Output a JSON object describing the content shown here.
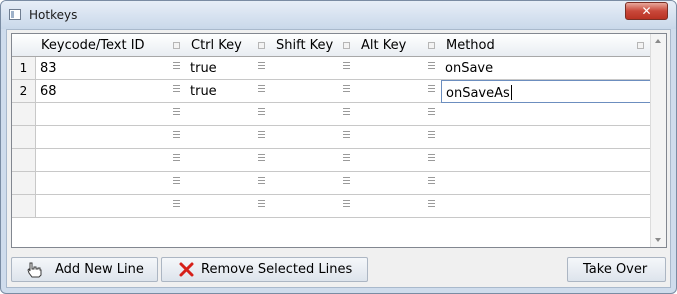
{
  "window": {
    "title": "Hotkeys",
    "close_glyph": "✕"
  },
  "grid": {
    "columns": [
      {
        "label": "Keycode/Text ID"
      },
      {
        "label": "Ctrl Key"
      },
      {
        "label": "Shift Key"
      },
      {
        "label": "Alt Key"
      },
      {
        "label": "Method"
      }
    ],
    "rows": [
      {
        "num": "1",
        "keycode": "83",
        "ctrl": "true",
        "shift": "",
        "alt": "",
        "method": "onSave"
      },
      {
        "num": "2",
        "keycode": "68",
        "ctrl": "true",
        "shift": "",
        "alt": "",
        "method": "onSaveAs"
      }
    ]
  },
  "buttons": {
    "add_new_line": "Add New Line",
    "remove_selected_lines": "Remove Selected Lines",
    "take_over": "Take Over"
  },
  "icons": {
    "add": "hand-pointer-icon",
    "remove": "red-x-icon"
  },
  "colors": {
    "remove_icon": "#d6201a",
    "close_button": "#c9483a"
  }
}
